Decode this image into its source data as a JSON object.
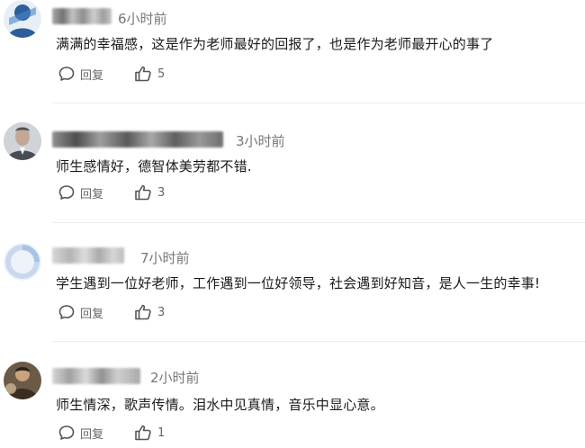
{
  "comments": [
    {
      "time": "6小时前",
      "text": "满满的幸福感，这是作为老师最好的回报了，也是作为老师最开心的事了",
      "reply_label": "回复",
      "likes": "5"
    },
    {
      "time": "3小时前",
      "text": "师生感情好，德智体美劳都不错.",
      "reply_label": "回复",
      "likes": "3"
    },
    {
      "time": "7小时前",
      "text": "学生遇到一位好老师，工作遇到一位好领导，社会遇到好知音，是人一生的幸事!",
      "reply_label": "回复",
      "likes": "3"
    },
    {
      "time": "2小时前",
      "text": "师生情深，歌声传情。泪水中见真情，音乐中显心意。",
      "reply_label": "回复",
      "likes": "1"
    }
  ],
  "icons": {
    "reply": "comment-bubble-icon",
    "like": "thumbs-up-icon"
  },
  "colors": {
    "text": "#1a1a1a",
    "meta": "#777777",
    "action": "#666666",
    "divider": "#ececec"
  }
}
